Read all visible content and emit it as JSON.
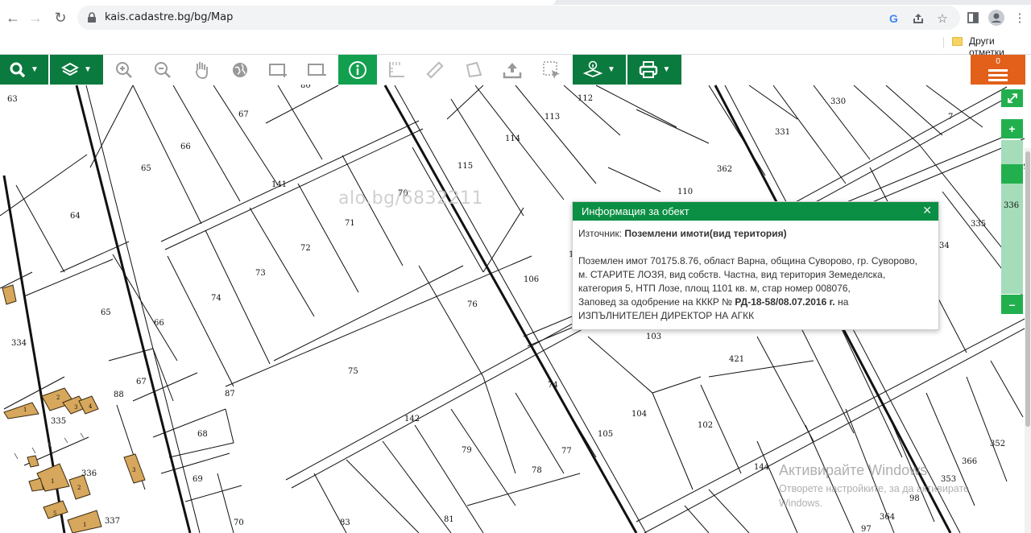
{
  "browser": {
    "url": "kais.cadastre.bg/bg/Map",
    "bookmarks_label": "Други отметки"
  },
  "map": {
    "watermark": "alo.bg/6832211",
    "zoom_level": "336",
    "parcel_labels": [
      "63",
      "67",
      "80",
      "112",
      "330",
      "113",
      "331",
      "7",
      "66",
      "114",
      "65",
      "141",
      "70",
      "115",
      "110",
      "362",
      "71",
      "64",
      "72",
      "39",
      "335",
      "73",
      "106",
      "1",
      "34",
      "74",
      "76",
      "65",
      "66",
      "334",
      "103",
      "421",
      "75",
      "67",
      "88",
      "87",
      "74",
      "142",
      "335",
      "104",
      "102",
      "1",
      "3",
      "4",
      "2",
      "68",
      "105",
      "79",
      "77",
      "336",
      "3",
      "69",
      "1",
      "78",
      "144",
      "353",
      "352",
      "366",
      "2",
      "5",
      "70",
      "337",
      "1",
      "83",
      "81",
      "364",
      "98",
      "97"
    ]
  },
  "popup": {
    "title": "Информация за обект",
    "source_label": "Източник:",
    "source_value": "Поземлени имоти(вид територия)",
    "desc_line1": "Поземлен имот 70175.8.76, област Варна, община Суворово, гр. Суворово,",
    "desc_line2": "м. СТАРИТЕ ЛОЗЯ, вид собств. Частна, вид територия Земеделска,",
    "desc_line3": "категория 5, НТП Лозе, площ 1101 кв. м, стар номер 008076,",
    "order_prefix": "Заповед за одобрение на КККР №",
    "order_number": "РД-18-58/08.07.2016 г.",
    "order_suffix": "на",
    "order_line2": "ИЗПЪЛНИТЕЛЕН ДИРЕКТОР НА АГКК"
  },
  "toolbar": {
    "notification_count": "0"
  },
  "windows_watermark": {
    "line1": "Активирайте Windows",
    "line2": "Отворете настройките, за да активирате Windows."
  },
  "colors": {
    "toolbar_green": "#0b7a3e",
    "info_active": "#12a04f",
    "popup_header": "#0b8f44",
    "zoom_green": "#22b04e",
    "menu_orange": "#e2601a",
    "building_fill": "#d6a75c"
  }
}
